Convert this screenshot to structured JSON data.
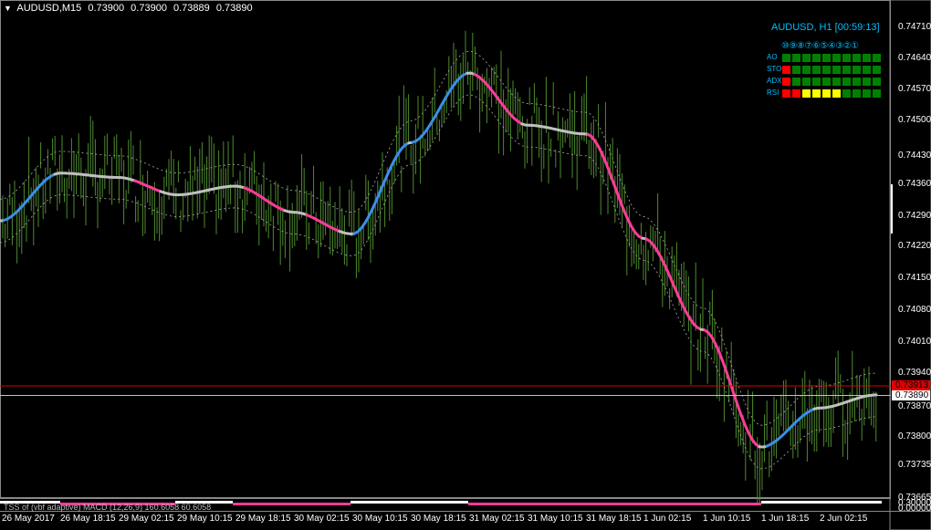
{
  "header": {
    "menu_icon": "triangle-down-icon",
    "symbol": "AUDUSD,M15",
    "open": "0.73900",
    "high": "0.73900",
    "low": "0.73889",
    "close": "0.73890"
  },
  "dashboard": {
    "title": "AUDUSD, H1 [00:59:13]",
    "timeframes_label": "⑩⑨⑧⑦⑥⑤④③②①",
    "indicators": [
      {
        "name": "AO",
        "cells": [
          "green",
          "green",
          "green",
          "green",
          "green",
          "green",
          "green",
          "green",
          "green",
          "green"
        ]
      },
      {
        "name": "STO",
        "cells": [
          "red",
          "green",
          "green",
          "green",
          "green",
          "green",
          "green",
          "green",
          "green",
          "green"
        ]
      },
      {
        "name": "ADX",
        "cells": [
          "red",
          "green",
          "green",
          "green",
          "green",
          "green",
          "green",
          "green",
          "green",
          "green"
        ]
      },
      {
        "name": "RSI",
        "cells": [
          "red",
          "red",
          "yellow",
          "yellow",
          "yellow",
          "yellow",
          "green",
          "green",
          "green",
          "green"
        ]
      }
    ],
    "colors": {
      "green": "#008000",
      "red": "#ff0000",
      "yellow": "#ffff00"
    }
  },
  "price_axis": {
    "labels": [
      "0.74710",
      "0.74640",
      "0.74570",
      "0.74500",
      "0.74430",
      "0.74360",
      "0.74290",
      "0.74220",
      "0.74150",
      "0.74080",
      "0.74010",
      "0.73940",
      "0.73870",
      "0.73800",
      "0.73735",
      "0.73665"
    ],
    "ask_tag": "0.73913",
    "bid_tag": "0.73890"
  },
  "time_axis": {
    "labels": [
      "26 May 2017",
      "26 May 18:15",
      "29 May 02:15",
      "29 May 10:15",
      "29 May 18:15",
      "30 May 02:15",
      "30 May 10:15",
      "30 May 18:15",
      "31 May 02:15",
      "31 May 10:15",
      "31 May 18:15",
      "1 Jun 02:15",
      "1 Jun 10:15",
      "1 Jun 18:15",
      "2 Jun 02:15"
    ]
  },
  "subwindow": {
    "label": "TSS of (vbf adaptive) MACD (12,26,9) 160.6058 60.6058",
    "axis_labels": [
      "0.30000",
      "0.00000"
    ]
  },
  "chart_data": {
    "type": "line",
    "title": "AUDUSD,M15",
    "xlabel": "",
    "ylabel": "",
    "ylim": [
      0.73665,
      0.74745
    ],
    "x": [
      "26 May 2017",
      "26 May 18:15",
      "29 May 02:15",
      "29 May 10:15",
      "29 May 18:15",
      "30 May 02:15",
      "30 May 10:15",
      "30 May 18:15",
      "31 May 02:15",
      "31 May 10:15",
      "31 May 18:15",
      "1 Jun 02:15",
      "1 Jun 10:15",
      "1 Jun 18:15",
      "2 Jun 02:15"
    ],
    "series": [
      {
        "values": [
          0.743,
          0.7441,
          0.744,
          0.7436,
          0.7438,
          0.7432,
          0.7427,
          0.7448,
          0.7464,
          0.7452,
          0.745,
          0.7426,
          0.7405,
          0.7378,
          0.7387
        ]
      }
    ],
    "ask_line": 0.73913,
    "bid_line": 0.7389,
    "colors": {
      "rising": "#3b8fe8",
      "falling": "#ff3b9a",
      "neutral": "#c0c0c0",
      "bars": "#4e8a2e",
      "band": "#aaaaaa"
    },
    "grid": false
  }
}
